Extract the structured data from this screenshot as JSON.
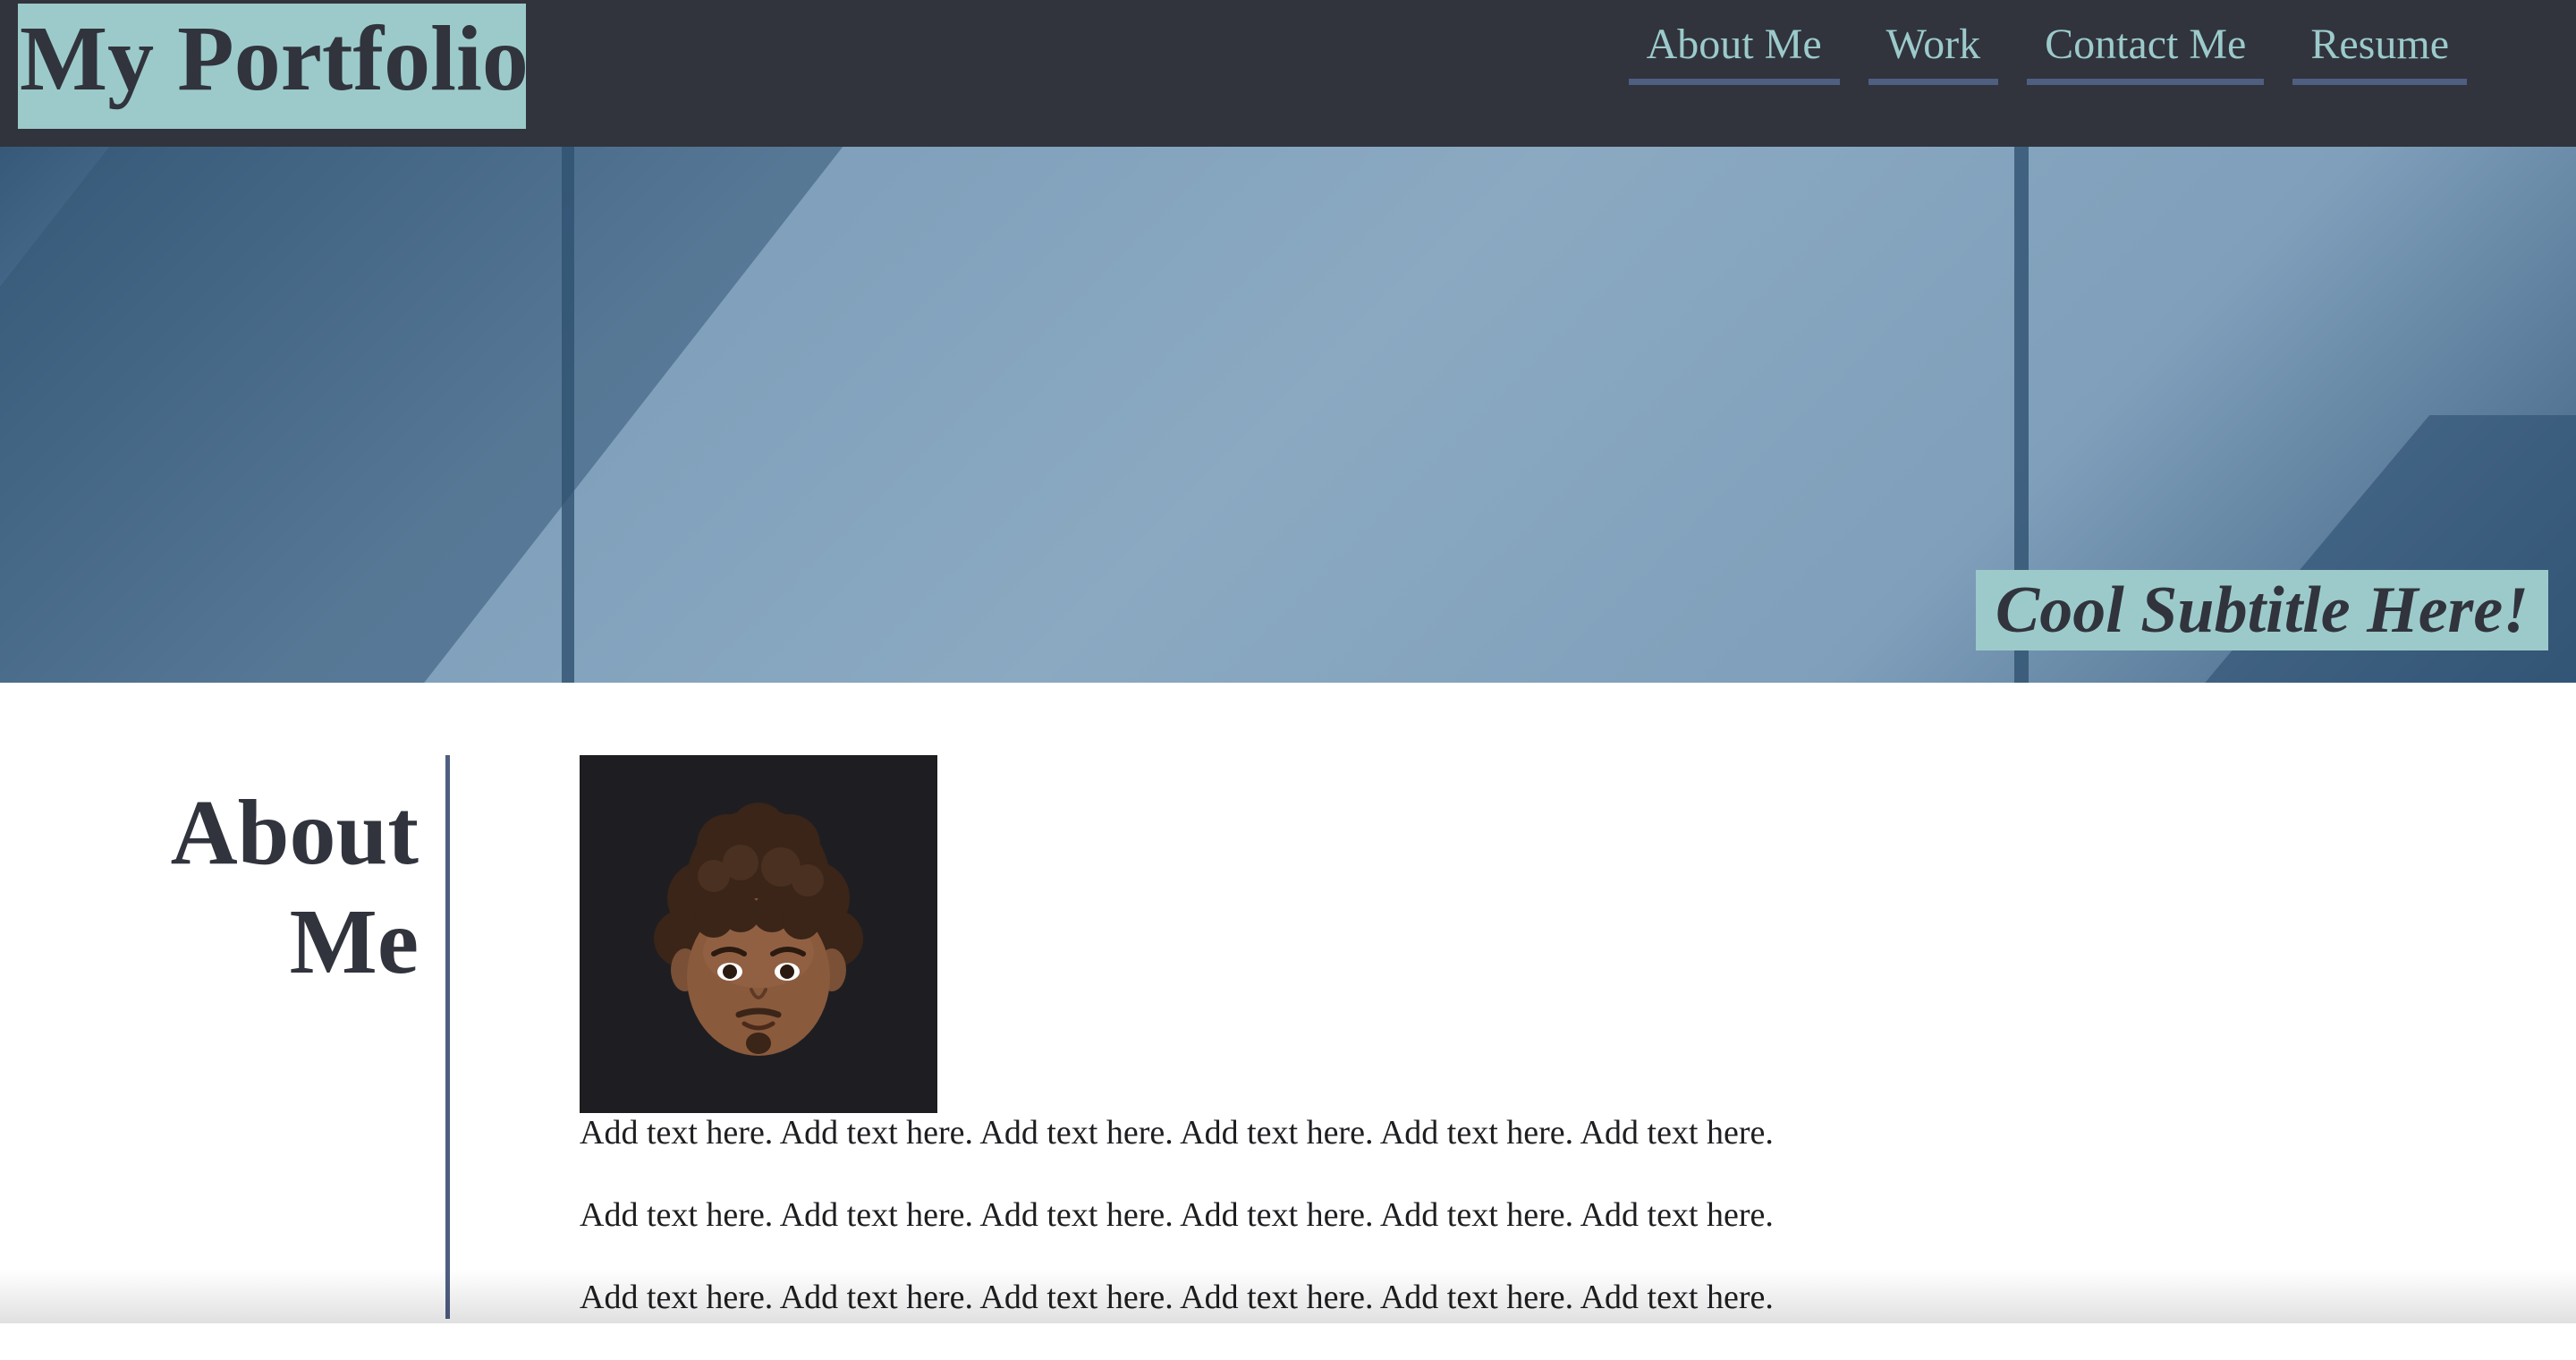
{
  "header": {
    "logo_text": "My Portfolio",
    "nav": [
      {
        "label": "About Me"
      },
      {
        "label": "Work"
      },
      {
        "label": "Contact Me"
      },
      {
        "label": "Resume"
      }
    ]
  },
  "hero": {
    "subtitle": "Cool Subtitle Here!"
  },
  "about": {
    "heading_line1": "About",
    "heading_line2": "Me",
    "avatar_icon": "memoji-avatar",
    "paragraphs": [
      "Add text here. Add text here. Add text here. Add text here. Add text here. Add text here.",
      "Add text here. Add text here. Add text here. Add text here. Add text here. Add text here.",
      "Add text here. Add text here. Add text here. Add text here. Add text here. Add text here."
    ]
  },
  "colors": {
    "header_bg": "#31343d",
    "accent": "#9ccacb",
    "nav_underline": "#4f5f82",
    "hero_blue": "#8ba9c1"
  }
}
